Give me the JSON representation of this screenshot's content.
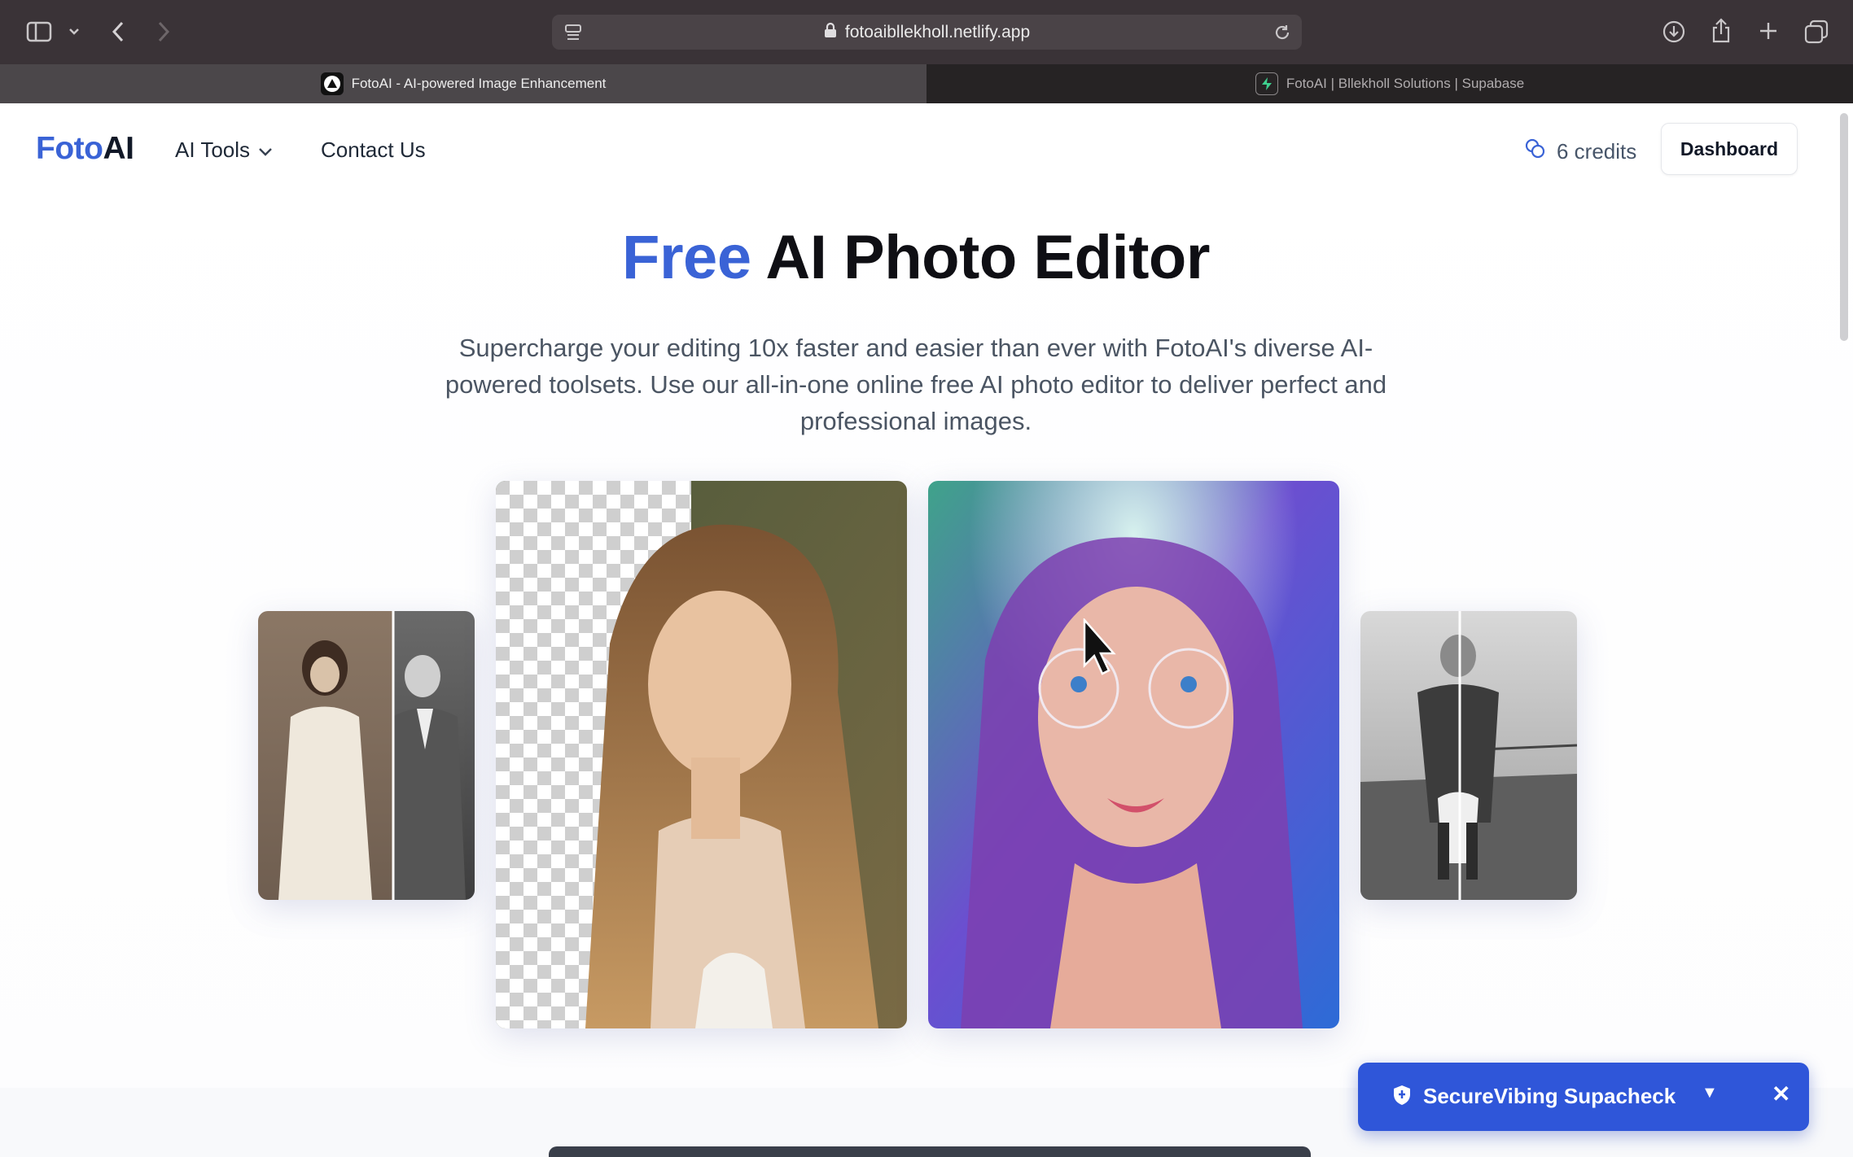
{
  "browser": {
    "url": "fotoaibllekholl.netlify.app",
    "tabs": [
      {
        "title": "FotoAI - AI-powered Image Enhancement"
      },
      {
        "title": "FotoAI | Bllekholl Solutions | Supabase"
      }
    ]
  },
  "nav": {
    "logo_part1": "Foto",
    "logo_part2": "AI",
    "ai_tools": "AI Tools",
    "contact": "Contact Us",
    "credits": "6 credits",
    "dashboard": "Dashboard"
  },
  "hero": {
    "title_accent": "Free",
    "title_rest": "AI Photo Editor",
    "subtitle": "Supercharge your editing 10x faster and easier than ever with FotoAI's diverse AI-powered toolsets. Use our all-in-one online free AI photo editor to deliver perfect and professional images."
  },
  "toast": {
    "label": "SecureVibing Supacheck",
    "caret": "▼",
    "close": "✕"
  },
  "colors": {
    "brand_blue": "#3a63d6",
    "toast_blue": "#2f56d9",
    "chrome_dark": "#3a3337"
  },
  "icons": [
    "sidebar-icon",
    "chevron-down-icon",
    "back-icon",
    "forward-icon",
    "reader-icon",
    "lock-icon",
    "reload-icon",
    "download-icon",
    "share-icon",
    "plus-icon",
    "tabs-overview-icon",
    "credits-icon",
    "shield-icon",
    "close-icon"
  ]
}
